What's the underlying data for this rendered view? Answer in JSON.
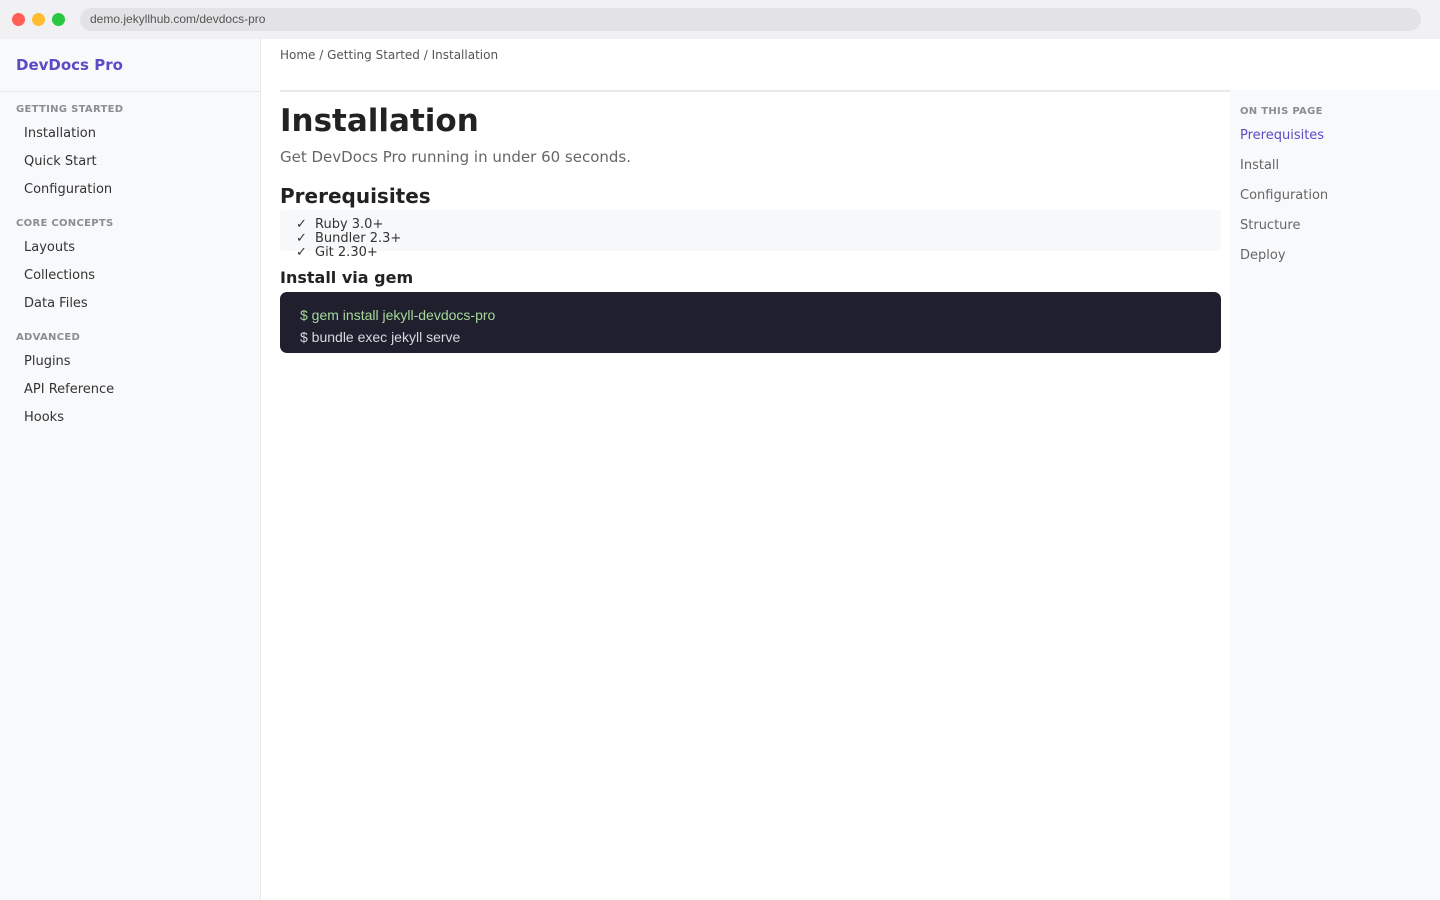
{
  "browser": {
    "url": "demo.jekyllhub.com/devdocs-pro"
  },
  "sidebar": {
    "brand": "DevDocs Pro",
    "sections": [
      {
        "title": "GETTING STARTED",
        "items": [
          "Installation",
          "Quick Start",
          "Configuration"
        ]
      },
      {
        "title": "CORE CONCEPTS",
        "items": [
          "Layouts",
          "Collections",
          "Data Files"
        ]
      },
      {
        "title": "ADVANCED",
        "items": [
          "Plugins",
          "API Reference",
          "Hooks"
        ]
      }
    ]
  },
  "breadcrumb": {
    "items": [
      "Home",
      "Getting Started",
      "Installation"
    ],
    "separator": "/"
  },
  "main": {
    "title": "Installation",
    "subtitle": "Get DevDocs Pro running in under 60 seconds.",
    "prereq_heading": "Prerequisites",
    "prerequisites": [
      "Ruby 3.0+",
      "Bundler 2.3+",
      "Git 2.30+"
    ],
    "check_glyph": "✓",
    "install_heading": "Install via gem",
    "code_lines": [
      "$ gem install jekyll-devdocs-pro",
      "$ bundle exec jekyll serve"
    ]
  },
  "toc": {
    "title": "ON THIS PAGE",
    "items": [
      "Prerequisites",
      "Install",
      "Configuration",
      "Structure",
      "Deploy"
    ],
    "active": "Prerequisites"
  },
  "colors": {
    "accent": "#5b4bc4",
    "code_bg": "#1f1f2e",
    "code_green": "#a6d99b"
  }
}
